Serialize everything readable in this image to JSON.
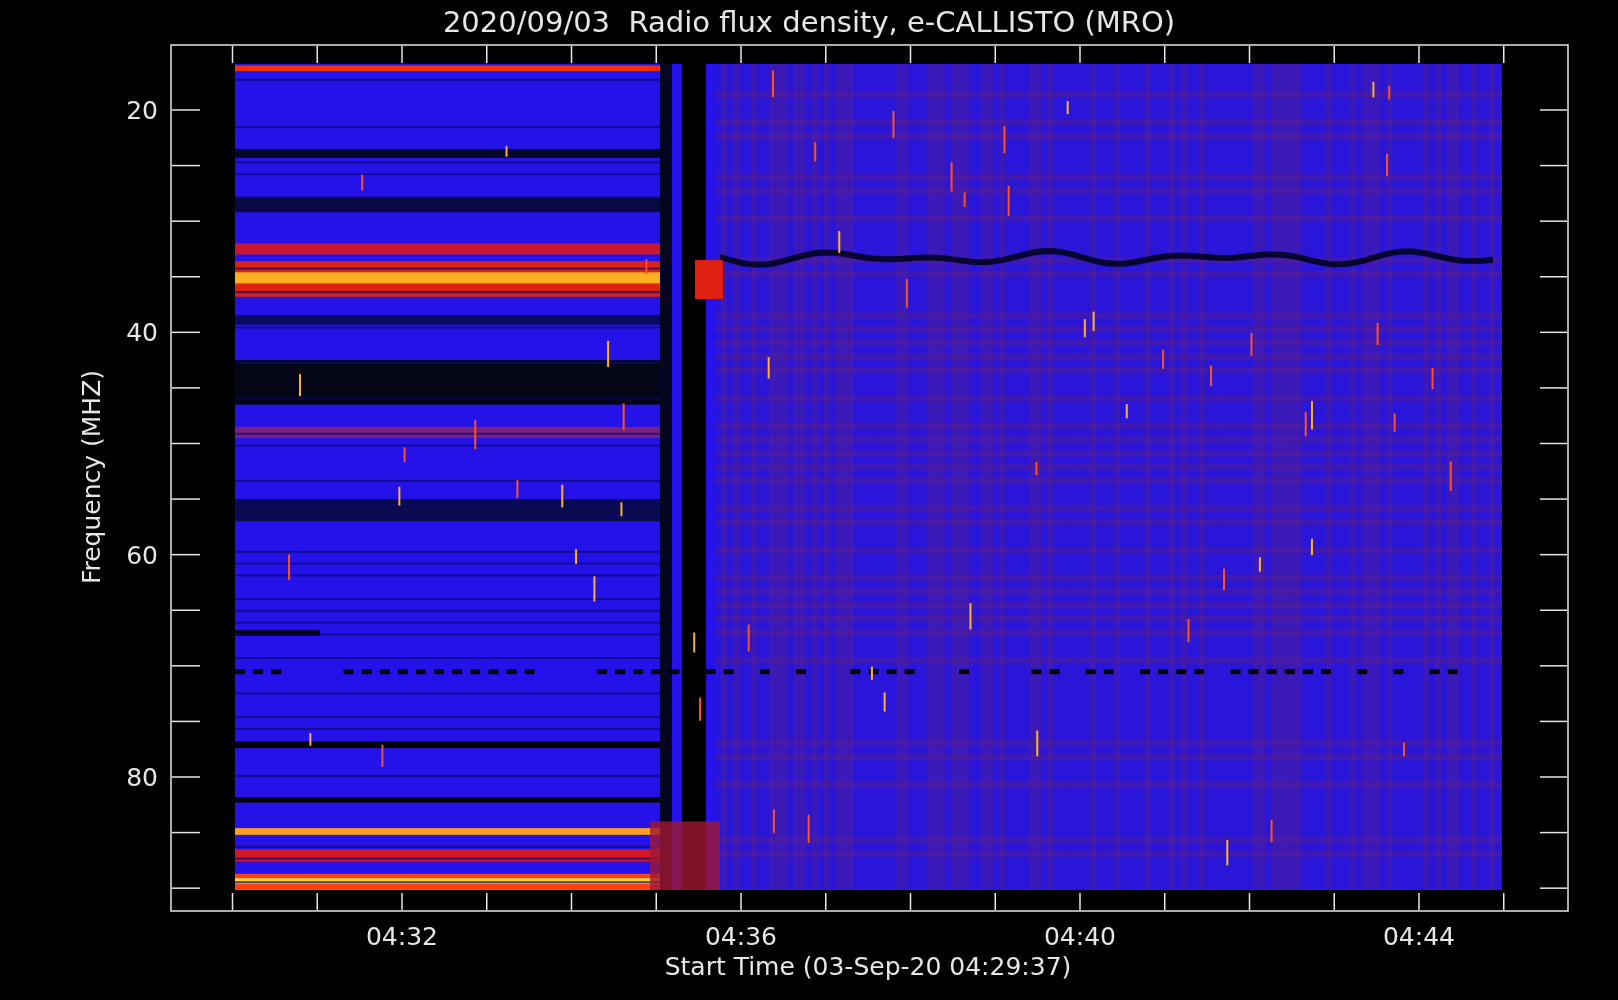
{
  "title": "2020/09/03  Radio flux density, e-CALLISTO (MRO)",
  "y_axis": {
    "label": "Frequency (MHZ)",
    "ticks": [
      "20",
      "40",
      "60",
      "80"
    ]
  },
  "x_axis": {
    "label": "Start Time (03-Sep-20 04:29:37)",
    "ticks": [
      "04:32",
      "04:36",
      "04:40",
      "04:44"
    ]
  }
}
